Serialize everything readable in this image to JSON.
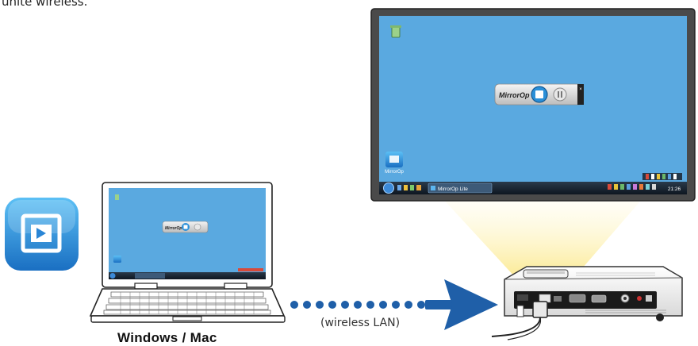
{
  "caption": "unite wireless.",
  "device_label": "Windows / Mac",
  "connection_label": "(wireless LAN)",
  "app_name": "MirrorOp",
  "taskbar_window_label": "MirrorOp Lite",
  "taskbar_clock": "21:26",
  "colors": {
    "desktop_blue": "#5aa9e0",
    "arrow_blue": "#1f5fa8",
    "app_icon_blue": "#1e8fdc",
    "projector_light": "#fbefa0"
  },
  "icons": [
    "mirrorop-app-icon",
    "recycle-bin-icon",
    "start-orb-icon",
    "play-icon",
    "pause-icon",
    "close-icon"
  ]
}
